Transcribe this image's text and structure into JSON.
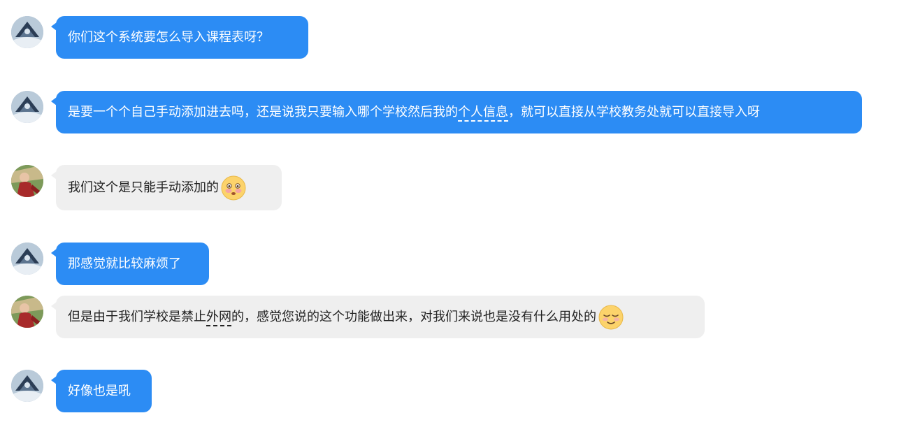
{
  "messages": [
    {
      "sender": "self",
      "avatar_icon": "self-avatar-icon",
      "text": "你们这个系统要怎么导入课程表呀？"
    },
    {
      "sender": "self",
      "avatar_icon": "self-avatar-icon",
      "text_before": "是要一个个自己手动添加进去吗，还是说我只要输入哪个学校然后我的",
      "highlight": "个人信息",
      "text_after": "，就可以直接从学校教务处就可以直接导入呀"
    },
    {
      "sender": "peer",
      "avatar_icon": "peer-avatar-icon",
      "text": "我们这个是只能手动添加的",
      "emoji": "flushed-face-emoji"
    },
    {
      "sender": "self",
      "avatar_icon": "self-avatar-icon",
      "text": "那感觉就比较麻烦了"
    },
    {
      "sender": "peer",
      "avatar_icon": "peer-avatar-icon",
      "text_before": "但是由于我们学校是禁止",
      "highlight": "外网",
      "text_after": "的，感觉您说的这个功能做出来，对我们来说也是没有什么用处的",
      "emoji": "relieved-face-emoji"
    },
    {
      "sender": "self",
      "avatar_icon": "self-avatar-icon",
      "text": "好像也是吼"
    }
  ],
  "colors": {
    "self_bubble": "#2c8cf4",
    "peer_bubble": "#efefef",
    "self_text": "#ffffff",
    "peer_text": "#222222"
  }
}
